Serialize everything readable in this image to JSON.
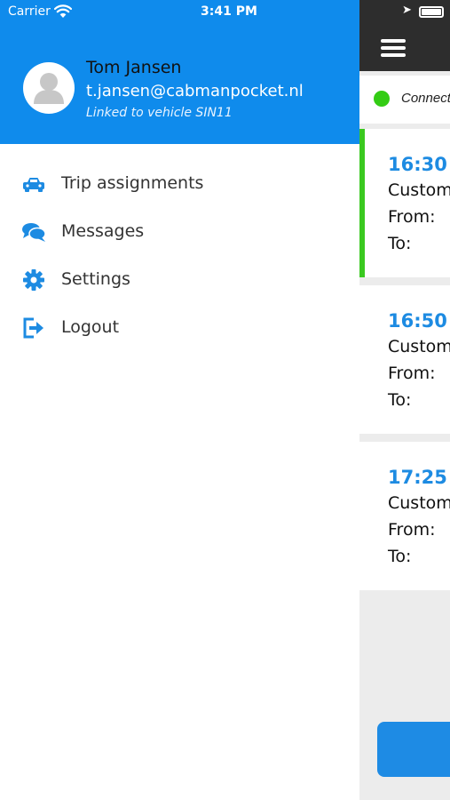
{
  "status_bar": {
    "carrier": "Carrier",
    "time": "3:41 PM"
  },
  "user": {
    "name": "Tom Jansen",
    "email": "t.jansen@cabmanpocket.nl",
    "vehicle": "Linked to vehicle SIN11"
  },
  "menu": {
    "items": [
      {
        "label": "Trip assignments",
        "icon": "car-icon"
      },
      {
        "label": "Messages",
        "icon": "chat-bubbles-icon"
      },
      {
        "label": "Settings",
        "icon": "gear-icon"
      },
      {
        "label": "Logout",
        "icon": "logout-icon"
      }
    ]
  },
  "background": {
    "connection": "Connect",
    "trips": [
      {
        "time": "16:30",
        "customer_label": "Custom",
        "from_label": "From:",
        "to_label": "To:"
      },
      {
        "time": "16:50",
        "customer_label": "Custom",
        "from_label": "From:",
        "to_label": "To:"
      },
      {
        "time": "17:25",
        "customer_label": "Custom",
        "from_label": "From:",
        "to_label": "To:"
      }
    ]
  },
  "colors": {
    "accent": "#0f8bec",
    "trip_time": "#1d8be2",
    "active_indicator": "#3ac920",
    "header_dark": "#2d2d2d"
  }
}
